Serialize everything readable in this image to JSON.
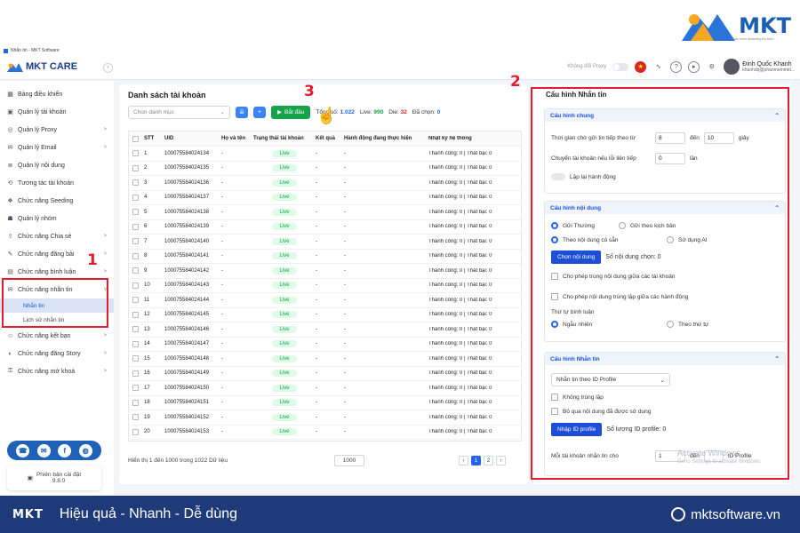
{
  "brand": {
    "logo": "MKT",
    "tagline": "Phần mềm Marketing Đa kênh"
  },
  "window": {
    "title": "Nhắn tin - MKT Software"
  },
  "header": {
    "app_name": "MKT CARE",
    "proxy_label": "Không đổi Proxy",
    "user_name": "Đinh Quốc Khanh",
    "user_email": "khanhdq@phanmemmkt..."
  },
  "sidebar": {
    "items": [
      {
        "label": "Bảng điều khiển",
        "icon": "dashboard-icon"
      },
      {
        "label": "Quản lý tài khoản",
        "icon": "account-icon"
      },
      {
        "label": "Quản lý Proxy",
        "icon": "proxy-icon",
        "chevron": ">"
      },
      {
        "label": "Quản lý Email",
        "icon": "email-icon",
        "chevron": ">"
      },
      {
        "label": "Quản lý nội dung",
        "icon": "content-icon"
      },
      {
        "label": "Tương tác tài khoản",
        "icon": "interaction-icon"
      },
      {
        "label": "Chức năng Seeding",
        "icon": "seeding-icon"
      },
      {
        "label": "Quản lý nhóm",
        "icon": "group-icon"
      },
      {
        "label": "Chức năng Chia sẻ",
        "icon": "share-icon",
        "chevron": ">"
      },
      {
        "label": "Chức năng đăng bài",
        "icon": "post-icon",
        "chevron": ">"
      },
      {
        "label": "Chức năng bình luận",
        "icon": "comment-icon",
        "chevron": ">"
      },
      {
        "label": "Chức năng nhắn tin",
        "icon": "message-icon",
        "chevron": "v"
      },
      {
        "label": "Chức năng kết bạn",
        "icon": "friend-icon",
        "chevron": ">"
      },
      {
        "label": "Chức năng đăng Story",
        "icon": "story-icon",
        "chevron": ">"
      },
      {
        "label": "Chức năng mở khoá",
        "icon": "unlock-icon",
        "chevron": ">"
      }
    ],
    "sub_items": [
      "Nhắn tin",
      "Lịch sử nhắn tin"
    ],
    "version_label": "Phiên bản cài đặt",
    "version": "9.8.0"
  },
  "annotations": {
    "n1": "1",
    "n2": "2",
    "n3": "3"
  },
  "main": {
    "title": "Danh sách tài khoản",
    "select_placeholder": "Chọn danh mục",
    "start_label": "Bắt đầu",
    "stats": {
      "total_label": "Tổng số:",
      "total": "1.022",
      "live_label": "Live:",
      "live": "990",
      "die_label": "Die:",
      "die": "32",
      "selected_label": "Đã chọn:",
      "selected": "0"
    },
    "columns": [
      "STT",
      "UID",
      "Họ và tên",
      "Trạng thái tài khoản",
      "Kết quả",
      "Hành động đang thực hiện",
      "Nhật ký hệ thống"
    ],
    "rows": [
      [
        "1",
        "100075584024134",
        "-",
        "Live",
        "-",
        "-",
        "Thành công: 0 | Thất bại: 0"
      ],
      [
        "2",
        "100075584024135",
        "-",
        "Live",
        "-",
        "-",
        "Thành công: 0 | Thất bại: 0"
      ],
      [
        "3",
        "100075584024136",
        "-",
        "Live",
        "-",
        "-",
        "Thành công: 0 | Thất bại: 0"
      ],
      [
        "4",
        "100075584024137",
        "-",
        "Live",
        "-",
        "-",
        "Thành công: 0 | Thất bại: 0"
      ],
      [
        "5",
        "100075584024138",
        "-",
        "Live",
        "-",
        "-",
        "Thành công: 0 | Thất bại: 0"
      ],
      [
        "6",
        "100075584024139",
        "-",
        "Live",
        "-",
        "-",
        "Thành công: 0 | Thất bại: 0"
      ],
      [
        "7",
        "100075584024140",
        "-",
        "Live",
        "-",
        "-",
        "Thành công: 0 | Thất bại: 0"
      ],
      [
        "8",
        "100075584024141",
        "-",
        "Live",
        "-",
        "-",
        "Thành công: 0 | Thất bại: 0"
      ],
      [
        "9",
        "100075584024142",
        "-",
        "Live",
        "-",
        "-",
        "Thành công: 0 | Thất bại: 0"
      ],
      [
        "10",
        "100075584024143",
        "-",
        "Live",
        "-",
        "-",
        "Thành công: 0 | Thất bại: 0"
      ],
      [
        "11",
        "100075584024144",
        "-",
        "Live",
        "-",
        "-",
        "Thành công: 0 | Thất bại: 0"
      ],
      [
        "12",
        "100075584024145",
        "-",
        "Live",
        "-",
        "-",
        "Thành công: 0 | Thất bại: 0"
      ],
      [
        "13",
        "100075584024146",
        "-",
        "Live",
        "-",
        "-",
        "Thành công: 0 | Thất bại: 0"
      ],
      [
        "14",
        "100075584024147",
        "-",
        "Live",
        "-",
        "-",
        "Thành công: 0 | Thất bại: 0"
      ],
      [
        "15",
        "100075584024148",
        "-",
        "Live",
        "-",
        "-",
        "Thành công: 0 | Thất bại: 0"
      ],
      [
        "16",
        "100075584024149",
        "-",
        "Live",
        "-",
        "-",
        "Thành công: 0 | Thất bại: 0"
      ],
      [
        "17",
        "100075584024150",
        "-",
        "Live",
        "-",
        "-",
        "Thành công: 0 | Thất bại: 0"
      ],
      [
        "18",
        "100075584024151",
        "-",
        "Live",
        "-",
        "-",
        "Thành công: 0 | Thất bại: 0"
      ],
      [
        "19",
        "100075584024152",
        "-",
        "Live",
        "-",
        "-",
        "Thành công: 0 | Thất bại: 0"
      ],
      [
        "20",
        "100075584024153",
        "-",
        "Live",
        "-",
        "-",
        "Thành công: 0 | Thất bại: 0"
      ]
    ],
    "footer": "Hiển thị 1 đến 1000 trong 1022 Dữ liệu",
    "page_size": "1000",
    "pages": [
      "1",
      "2"
    ]
  },
  "panel": {
    "title": "Cấu hình Nhắn tin",
    "general": {
      "head": "Cấu hình chung",
      "delay_label": "Thời gian chờ gửi tin tiếp theo từ",
      "delay_from": "8",
      "to_label": "đến",
      "delay_to": "10",
      "unit_sec": "giây",
      "switch_label": "Chuyển tài khoản nếu lỗi liên tiếp",
      "switch_val": "0",
      "unit_times": "lần",
      "repeat_label": "Lặp lại hành động"
    },
    "content": {
      "head": "Cấu hình nội dung",
      "send_normal": "Gửi Thường",
      "send_script": "Gửi theo kịch bản",
      "by_content": "Theo nội dung có sẵn",
      "use_ai": "Sử dụng AI",
      "choose_btn": "Chọn nội dung",
      "count_label": "Số nội dung chọn: 0",
      "allow_dup_accounts": "Cho phép trùng nội dung giữa các tài khoản",
      "allow_dup_actions": "Cho phép nội dung trùng lặp giữa các hành động",
      "order_label": "Thứ tự bình luận",
      "random": "Ngẫu nhiên",
      "sequential": "Theo thứ tự"
    },
    "messaging": {
      "head": "Cấu hình Nhắn tin",
      "mode": "Nhắn tin theo ID Profile",
      "no_dup": "Không trùng lặp",
      "skip_used": "Bỏ qua nội dung đã được sử dụng",
      "import_btn": "Nhập ID profile",
      "count_label": "Số lượng ID profile: 0",
      "per_account_label": "Mỗi tài khoản nhắn tin cho",
      "per_account_from": "1",
      "to_label": "đến",
      "unit": "ID Profile"
    }
  },
  "watermark": {
    "line1": "Activate Windows",
    "line2": "Go to Settings to activate Windows."
  },
  "bottom": {
    "logo": "MKT",
    "slogan": "Hiệu quả - Nhanh - Dễ dùng",
    "website": "mktsoftware.vn"
  },
  "colors": {
    "primary": "#1d4ed8",
    "live_green": "#16a34a",
    "annotation_red": "#e11d2e",
    "footer_bg": "#1e3a78"
  }
}
